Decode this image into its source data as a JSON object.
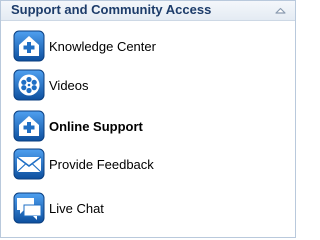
{
  "panel": {
    "title": "Support and Community Access",
    "collapse_icon": "chevron-up-icon"
  },
  "items": [
    {
      "label": "Knowledge Center",
      "icon": "medical-plus-icon"
    },
    {
      "label": "Videos",
      "icon": "film-reel-icon"
    },
    {
      "label": "Online Support",
      "icon": "medical-plus-icon"
    },
    {
      "label": "Provide Feedback",
      "icon": "envelope-icon"
    },
    {
      "label": "Live Chat",
      "icon": "chat-bubbles-icon"
    }
  ],
  "colors": {
    "title_text": "#1d3c6a",
    "icon_blue": "#1f6fc5",
    "panel_border": "#b9c9dc"
  }
}
